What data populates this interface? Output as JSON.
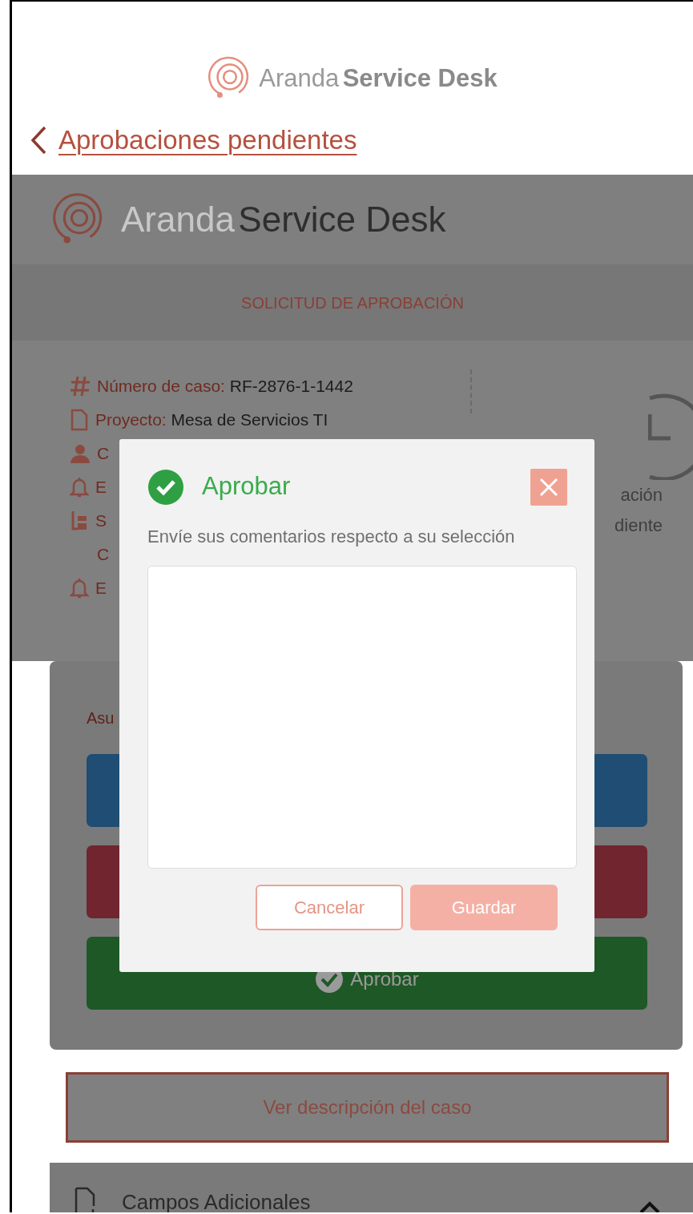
{
  "header": {
    "logo": {
      "light": "Aranda",
      "bold": "Service Desk"
    },
    "back_link": "Aprobaciones pendientes"
  },
  "page": {
    "logo": {
      "light": "Aranda",
      "bold": "Service Desk"
    },
    "section_title": "SOLICITUD DE APROBACIÓN",
    "case_info": [
      {
        "kind": "hash",
        "label": "Número de caso:",
        "value": "RF-2876-1-1442"
      },
      {
        "kind": "document",
        "label": "Proyecto:",
        "value": "Mesa de Servicios TI"
      },
      {
        "kind": "person",
        "label": "C"
      },
      {
        "kind": "bell",
        "label": "E"
      },
      {
        "kind": "hierarchy",
        "label": "S"
      },
      {
        "kind": "continuation",
        "label": "C"
      },
      {
        "kind": "bell",
        "label": "E"
      }
    ],
    "status_lines": [
      "ación",
      "diente"
    ],
    "actions": {
      "label": "Asu",
      "buttons": [
        {
          "color": "#1f4d73"
        },
        {
          "color": "#70252f"
        },
        {
          "color": "#1e5826",
          "label": "Aprobar"
        }
      ]
    },
    "description_button": "Ver descripción del caso",
    "accordion": {
      "title": "Campos Adicionales",
      "expanded": true
    }
  },
  "modal": {
    "title": "Aprobar",
    "message": "Envíe sus comentarios respecto a su selección",
    "buttons": [
      {
        "label": "Cancelar",
        "kind": "outline",
        "disabled": false
      },
      {
        "label": "Guardar",
        "kind": "primary",
        "disabled": true
      }
    ]
  }
}
